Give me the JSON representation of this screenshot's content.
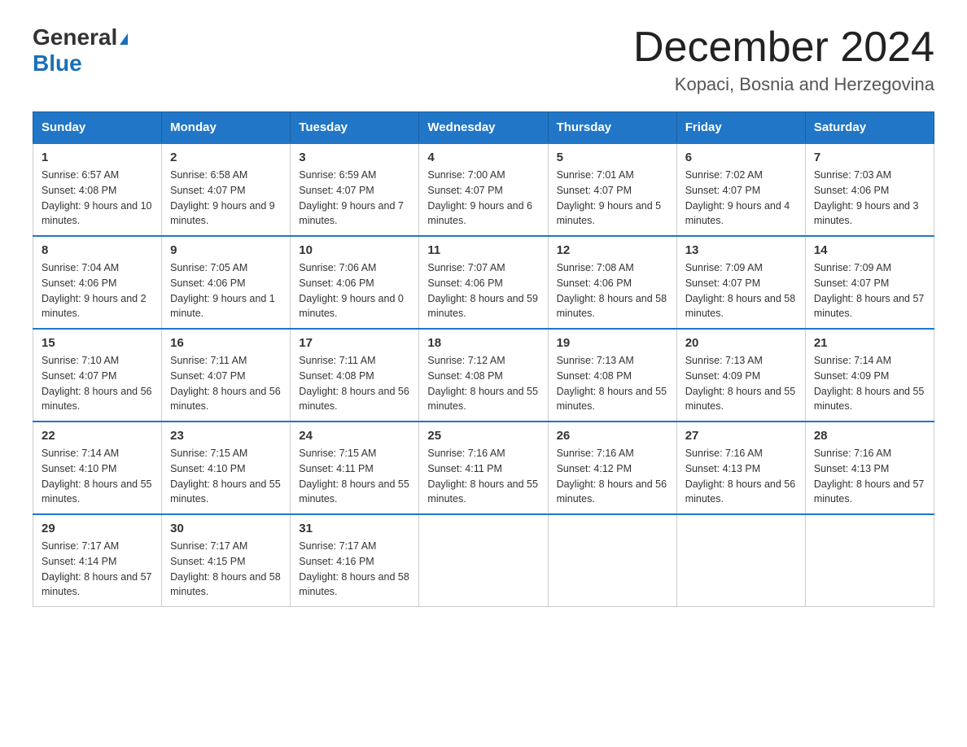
{
  "header": {
    "logo_general": "General",
    "logo_blue": "Blue",
    "month_title": "December 2024",
    "location": "Kopaci, Bosnia and Herzegovina"
  },
  "days_of_week": [
    "Sunday",
    "Monday",
    "Tuesday",
    "Wednesday",
    "Thursday",
    "Friday",
    "Saturday"
  ],
  "weeks": [
    [
      {
        "day": "1",
        "sunrise": "6:57 AM",
        "sunset": "4:08 PM",
        "daylight": "9 hours and 10 minutes."
      },
      {
        "day": "2",
        "sunrise": "6:58 AM",
        "sunset": "4:07 PM",
        "daylight": "9 hours and 9 minutes."
      },
      {
        "day": "3",
        "sunrise": "6:59 AM",
        "sunset": "4:07 PM",
        "daylight": "9 hours and 7 minutes."
      },
      {
        "day": "4",
        "sunrise": "7:00 AM",
        "sunset": "4:07 PM",
        "daylight": "9 hours and 6 minutes."
      },
      {
        "day": "5",
        "sunrise": "7:01 AM",
        "sunset": "4:07 PM",
        "daylight": "9 hours and 5 minutes."
      },
      {
        "day": "6",
        "sunrise": "7:02 AM",
        "sunset": "4:07 PM",
        "daylight": "9 hours and 4 minutes."
      },
      {
        "day": "7",
        "sunrise": "7:03 AM",
        "sunset": "4:06 PM",
        "daylight": "9 hours and 3 minutes."
      }
    ],
    [
      {
        "day": "8",
        "sunrise": "7:04 AM",
        "sunset": "4:06 PM",
        "daylight": "9 hours and 2 minutes."
      },
      {
        "day": "9",
        "sunrise": "7:05 AM",
        "sunset": "4:06 PM",
        "daylight": "9 hours and 1 minute."
      },
      {
        "day": "10",
        "sunrise": "7:06 AM",
        "sunset": "4:06 PM",
        "daylight": "9 hours and 0 minutes."
      },
      {
        "day": "11",
        "sunrise": "7:07 AM",
        "sunset": "4:06 PM",
        "daylight": "8 hours and 59 minutes."
      },
      {
        "day": "12",
        "sunrise": "7:08 AM",
        "sunset": "4:06 PM",
        "daylight": "8 hours and 58 minutes."
      },
      {
        "day": "13",
        "sunrise": "7:09 AM",
        "sunset": "4:07 PM",
        "daylight": "8 hours and 58 minutes."
      },
      {
        "day": "14",
        "sunrise": "7:09 AM",
        "sunset": "4:07 PM",
        "daylight": "8 hours and 57 minutes."
      }
    ],
    [
      {
        "day": "15",
        "sunrise": "7:10 AM",
        "sunset": "4:07 PM",
        "daylight": "8 hours and 56 minutes."
      },
      {
        "day": "16",
        "sunrise": "7:11 AM",
        "sunset": "4:07 PM",
        "daylight": "8 hours and 56 minutes."
      },
      {
        "day": "17",
        "sunrise": "7:11 AM",
        "sunset": "4:08 PM",
        "daylight": "8 hours and 56 minutes."
      },
      {
        "day": "18",
        "sunrise": "7:12 AM",
        "sunset": "4:08 PM",
        "daylight": "8 hours and 55 minutes."
      },
      {
        "day": "19",
        "sunrise": "7:13 AM",
        "sunset": "4:08 PM",
        "daylight": "8 hours and 55 minutes."
      },
      {
        "day": "20",
        "sunrise": "7:13 AM",
        "sunset": "4:09 PM",
        "daylight": "8 hours and 55 minutes."
      },
      {
        "day": "21",
        "sunrise": "7:14 AM",
        "sunset": "4:09 PM",
        "daylight": "8 hours and 55 minutes."
      }
    ],
    [
      {
        "day": "22",
        "sunrise": "7:14 AM",
        "sunset": "4:10 PM",
        "daylight": "8 hours and 55 minutes."
      },
      {
        "day": "23",
        "sunrise": "7:15 AM",
        "sunset": "4:10 PM",
        "daylight": "8 hours and 55 minutes."
      },
      {
        "day": "24",
        "sunrise": "7:15 AM",
        "sunset": "4:11 PM",
        "daylight": "8 hours and 55 minutes."
      },
      {
        "day": "25",
        "sunrise": "7:16 AM",
        "sunset": "4:11 PM",
        "daylight": "8 hours and 55 minutes."
      },
      {
        "day": "26",
        "sunrise": "7:16 AM",
        "sunset": "4:12 PM",
        "daylight": "8 hours and 56 minutes."
      },
      {
        "day": "27",
        "sunrise": "7:16 AM",
        "sunset": "4:13 PM",
        "daylight": "8 hours and 56 minutes."
      },
      {
        "day": "28",
        "sunrise": "7:16 AM",
        "sunset": "4:13 PM",
        "daylight": "8 hours and 57 minutes."
      }
    ],
    [
      {
        "day": "29",
        "sunrise": "7:17 AM",
        "sunset": "4:14 PM",
        "daylight": "8 hours and 57 minutes."
      },
      {
        "day": "30",
        "sunrise": "7:17 AM",
        "sunset": "4:15 PM",
        "daylight": "8 hours and 58 minutes."
      },
      {
        "day": "31",
        "sunrise": "7:17 AM",
        "sunset": "4:16 PM",
        "daylight": "8 hours and 58 minutes."
      },
      null,
      null,
      null,
      null
    ]
  ],
  "labels": {
    "sunrise": "Sunrise:",
    "sunset": "Sunset:",
    "daylight": "Daylight:"
  }
}
